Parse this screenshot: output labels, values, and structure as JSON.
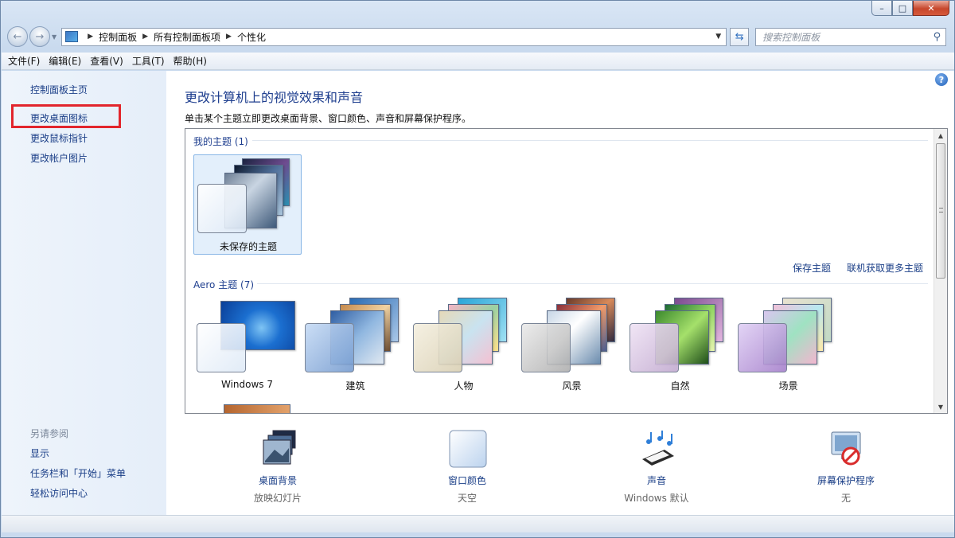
{
  "window": {
    "caption": {
      "minimize": "–",
      "maximize": "□",
      "close": "✕"
    }
  },
  "nav": {
    "back_glyph": "←",
    "forward_glyph": "→",
    "breadcrumbs": [
      "控制面板",
      "所有控制面板项",
      "个性化"
    ],
    "search_placeholder": "搜索控制面板"
  },
  "menu": {
    "items": [
      "文件(F)",
      "编辑(E)",
      "查看(V)",
      "工具(T)",
      "帮助(H)"
    ]
  },
  "sidebar": {
    "home": "控制面板主页",
    "links": [
      "更改桌面图标",
      "更改鼠标指针",
      "更改帐户图片"
    ],
    "see_also_title": "另请参阅",
    "see_also": [
      "显示",
      "任务栏和「开始」菜单",
      "轻松访问中心"
    ],
    "highlight_color": "#e2252c"
  },
  "main": {
    "title": "更改计算机上的视觉效果和声音",
    "subtitle": "单击某个主题立即更改桌面背景、窗口颜色、声音和屏幕保护程序。",
    "help_glyph": "?",
    "my_themes_header": "我的主题 (1)",
    "unsaved_theme": "未保存的主题",
    "save_theme": "保存主题",
    "get_more_themes": "联机获取更多主题",
    "aero_header": "Aero 主题 (7)",
    "aero_themes": [
      "Windows 7",
      "建筑",
      "人物",
      "风景",
      "自然",
      "场景"
    ]
  },
  "options": {
    "desktop_background": {
      "title": "桌面背景",
      "value": "放映幻灯片"
    },
    "window_color": {
      "title": "窗口颜色",
      "value": "天空"
    },
    "sounds": {
      "title": "声音",
      "value": "Windows 默认"
    },
    "screen_saver": {
      "title": "屏幕保护程序",
      "value": "无"
    }
  },
  "colors": {
    "link": "#1a3e87",
    "accent_blue": "#1f3f8f"
  }
}
